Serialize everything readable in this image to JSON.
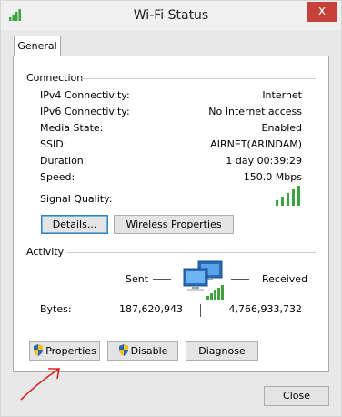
{
  "window": {
    "title": "Wi-Fi Status",
    "close_glyph": "x"
  },
  "tabs": [
    {
      "label": "General"
    }
  ],
  "connection": {
    "heading": "Connection",
    "rows": [
      {
        "label": "IPv4 Connectivity:",
        "value": "Internet"
      },
      {
        "label": "IPv6 Connectivity:",
        "value": "No Internet access"
      },
      {
        "label": "Media State:",
        "value": "Enabled"
      },
      {
        "label": "SSID:",
        "value": "AIRNET(ARINDAM)"
      },
      {
        "label": "Duration:",
        "value": "1 day 00:39:29"
      },
      {
        "label": "Speed:",
        "value": "150.0 Mbps"
      }
    ],
    "signal_quality_label": "Signal Quality:",
    "signal_bars_lit": 5,
    "signal_bars_total": 5,
    "details_button": "Details...",
    "wireless_properties_button": "Wireless Properties"
  },
  "activity": {
    "heading": "Activity",
    "sent_label": "Sent",
    "received_label": "Received",
    "bytes_label": "Bytes:",
    "bytes_sent": "187,620,943",
    "bytes_received": "4,766,933,732"
  },
  "actions": {
    "properties_button": "Properties",
    "disable_button": "Disable",
    "diagnose_button": "Diagnose"
  },
  "footer": {
    "close_button": "Close"
  },
  "colors": {
    "signal_green": "#3da33d",
    "close_red": "#c7413a",
    "annotation_red": "#e02020"
  },
  "icons": [
    "wifi-signal-icon",
    "network-computers-icon",
    "uac-shield-icon",
    "close-icon"
  ]
}
